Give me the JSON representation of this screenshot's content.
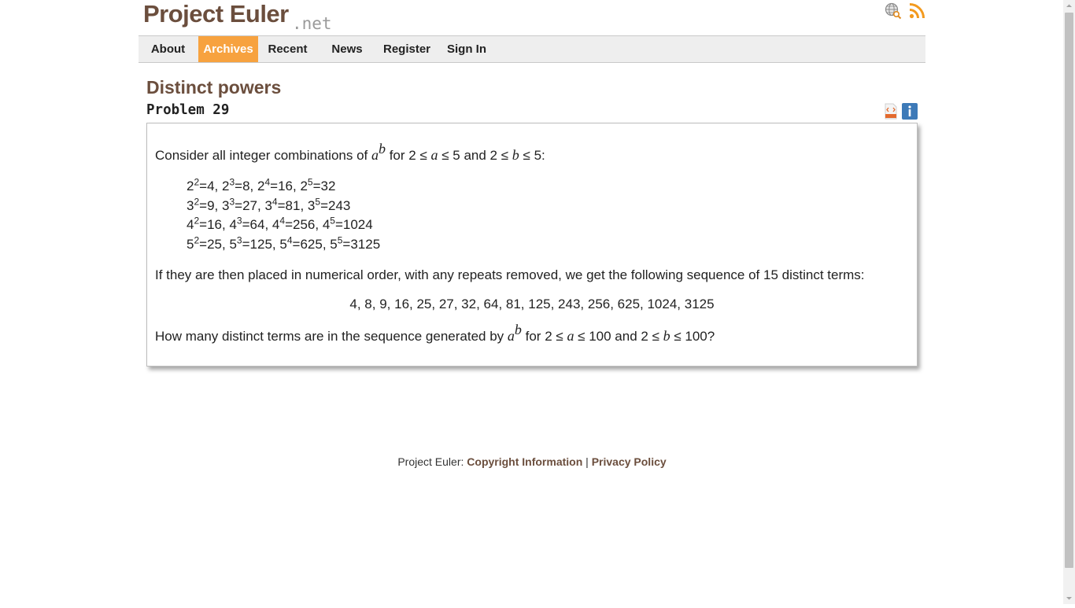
{
  "brand": {
    "name": "Project Euler",
    "suffix": ".net"
  },
  "nav": {
    "items": [
      {
        "label": "About",
        "active": false
      },
      {
        "label": "Archives",
        "active": true
      },
      {
        "label": "Recent",
        "active": false
      },
      {
        "label": "News",
        "active": false
      },
      {
        "label": "Register",
        "active": false
      },
      {
        "label": "Sign In",
        "active": false
      }
    ]
  },
  "problem": {
    "title": "Distinct powers",
    "subtitle": "Problem 29",
    "intro": {
      "pre": "Consider all integer combinations of ",
      "var_a": "a",
      "sup_b": "b",
      "mid1": " for 2 ≤ ",
      "var_a2": "a",
      "mid2": " ≤ 5 and 2 ≤ ",
      "var_b": "b",
      "post": " ≤ 5:"
    },
    "power_rows": [
      [
        [
          "2",
          "2",
          "4"
        ],
        [
          "2",
          "3",
          "8"
        ],
        [
          "2",
          "4",
          "16"
        ],
        [
          "2",
          "5",
          "32"
        ]
      ],
      [
        [
          "3",
          "2",
          "9"
        ],
        [
          "3",
          "3",
          "27"
        ],
        [
          "3",
          "4",
          "81"
        ],
        [
          "3",
          "5",
          "243"
        ]
      ],
      [
        [
          "4",
          "2",
          "16"
        ],
        [
          "4",
          "3",
          "64"
        ],
        [
          "4",
          "4",
          "256"
        ],
        [
          "4",
          "5",
          "1024"
        ]
      ],
      [
        [
          "5",
          "2",
          "25"
        ],
        [
          "5",
          "3",
          "125"
        ],
        [
          "5",
          "4",
          "625"
        ],
        [
          "5",
          "5",
          "3125"
        ]
      ]
    ],
    "sequence_intro": "If they are then placed in numerical order, with any repeats removed, we get the following sequence of 15 distinct terms:",
    "sequence": "4, 8, 9, 16, 25, 27, 32, 64, 81, 125, 243, 256, 625, 1024, 3125",
    "question": {
      "pre": "How many distinct terms are in the sequence generated by ",
      "var_a": "a",
      "sup_b": "b",
      "mid1": " for 2 ≤ ",
      "var_a2": "a",
      "mid2": " ≤ 100 and 2 ≤ ",
      "var_b": "b",
      "post": " ≤ 100?"
    }
  },
  "footer": {
    "prefix": "Project Euler: ",
    "copyright": "Copyright Information",
    "separator": " | ",
    "privacy": "Privacy Policy"
  },
  "icons": {
    "search": "globe-search-icon",
    "rss": "rss-icon",
    "html": "html-icon",
    "info": "info-icon"
  },
  "colors": {
    "brand": "#6b4e3d",
    "accent": "#f7a23f",
    "info": "#3d7ab8"
  }
}
